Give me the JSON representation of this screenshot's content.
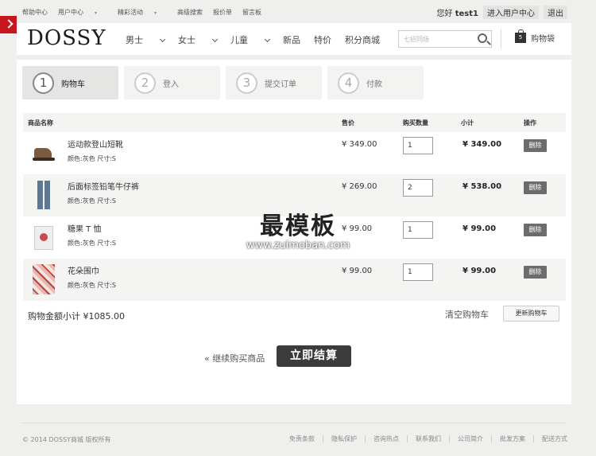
{
  "topbar": {
    "links": [
      "帮助中心",
      "用户中心",
      "精彩活动",
      "高级搜索",
      "报价单",
      "留言板"
    ],
    "greeting_prefix": "您好",
    "username": "test1",
    "user_center": "进入用户中心",
    "logout": "退出"
  },
  "header": {
    "logo": "DOSSY",
    "nav": [
      "男士",
      "女士",
      "儿童",
      "新品",
      "特价",
      "积分商城"
    ],
    "search_placeholder": "七招同场",
    "cart_label": "购物袋",
    "cart_count": "5"
  },
  "steps": [
    {
      "num": "1",
      "label": "购物车"
    },
    {
      "num": "2",
      "label": "登入"
    },
    {
      "num": "3",
      "label": "提交订单"
    },
    {
      "num": "4",
      "label": "付款"
    }
  ],
  "table": {
    "headers": {
      "name": "商品名称",
      "price": "售价",
      "qty": "购买数量",
      "subtotal": "小计",
      "action": "操作"
    },
    "rows": [
      {
        "name": "运动款登山短靴",
        "attr": "颜色:灰色 尺寸:S",
        "price": "¥ 349.00",
        "qty": "1",
        "subtotal": "¥ 349.00",
        "action": "删除",
        "thumb": "boot"
      },
      {
        "name": "后面标签铅笔牛仔裤",
        "attr": "颜色:灰色 尺寸:S",
        "price": "¥ 269.00",
        "qty": "2",
        "subtotal": "¥ 538.00",
        "action": "删除",
        "thumb": "jeans"
      },
      {
        "name": "糖果 T 恤",
        "attr": "颜色:灰色 尺寸:S",
        "price": "¥ 99.00",
        "qty": "1",
        "subtotal": "¥ 99.00",
        "action": "删除",
        "thumb": "tee"
      },
      {
        "name": "花朵围巾",
        "attr": "颜色:灰色 尺寸:S",
        "price": "¥ 99.00",
        "qty": "1",
        "subtotal": "¥ 99.00",
        "action": "删除",
        "thumb": "scarf"
      }
    ]
  },
  "summary": {
    "total_label": "购物金额小计 ¥1085.00",
    "clear_cart": "清空购物车",
    "update_cart": "更新购物车",
    "continue": "« 继续购买商品",
    "checkout": "立即结算"
  },
  "watermark": {
    "title": "最模板",
    "url": "www.zuimoban.com"
  },
  "footer": {
    "copyright": "© 2014 DOSSY商城 版权所有",
    "links": [
      "免责条款",
      "隐私保护",
      "咨询热点",
      "联系我们",
      "公司简介",
      "批发方案",
      "配送方式"
    ]
  },
  "colors": {
    "accent_red": "#c8161e",
    "dark_button": "#3b3b3b"
  }
}
